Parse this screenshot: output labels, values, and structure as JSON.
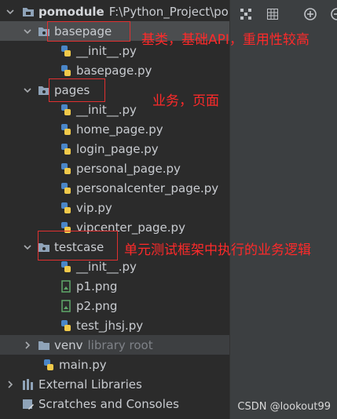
{
  "tree": {
    "root": {
      "name": "pomodule",
      "path": "F:\\Python_Project\\po"
    },
    "basepage": {
      "name": "basepage",
      "children": [
        "__init__.py",
        "basepage.py"
      ]
    },
    "pages": {
      "name": "pages",
      "children": [
        "__init__.py",
        "home_page.py",
        "login_page.py",
        "personal_page.py",
        "personalcenter_page.py",
        "vip.py",
        "vipcenter_page.py"
      ]
    },
    "testcase": {
      "name": "testcase",
      "children": [
        "__init__.py",
        "p1.png",
        "p2.png",
        "test_jhsj.py"
      ]
    },
    "venv": {
      "name": "venv",
      "hint": "library root"
    },
    "main": "main.py",
    "external": "External Libraries",
    "scratches": "Scratches and Consoles"
  },
  "annotations": {
    "basepage": "基类，基础API，重用性较高",
    "pages": "业务，页面",
    "testcase": "单元测试框架中执行的业务逻辑"
  },
  "watermark": "CSDN @lookout99",
  "colors": {
    "annotation": "#e03030",
    "folder": "#8fa3b8",
    "python_blue": "#4a86c8",
    "python_yellow": "#f0c94a"
  }
}
